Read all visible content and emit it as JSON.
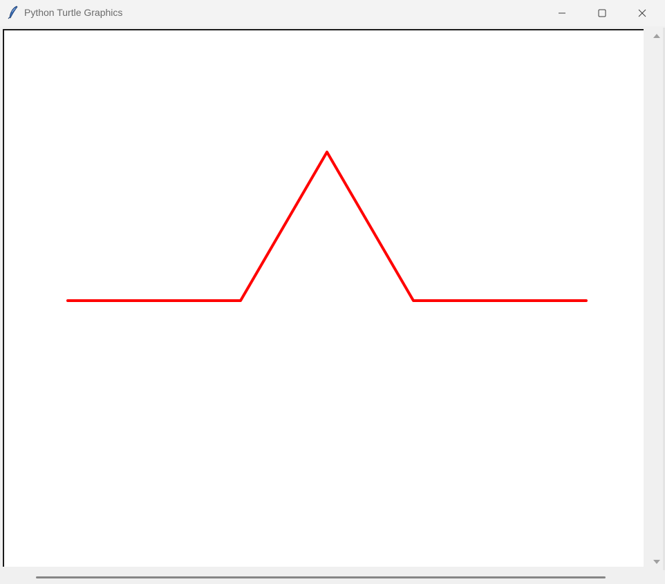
{
  "window": {
    "title": "Python Turtle Graphics",
    "app_icon": "feather-icon",
    "controls": [
      "minimize-icon",
      "maximize-icon",
      "close-icon"
    ]
  },
  "canvas": {
    "background": "#ffffff",
    "pen_color": "#ff0000",
    "shape": "koch-curve-first-iteration"
  },
  "scrollbars": {
    "vertical": {
      "up_arrow": "up-arrow-icon",
      "down_arrow": "down-arrow-icon"
    },
    "horizontal": {
      "visible": true
    }
  }
}
